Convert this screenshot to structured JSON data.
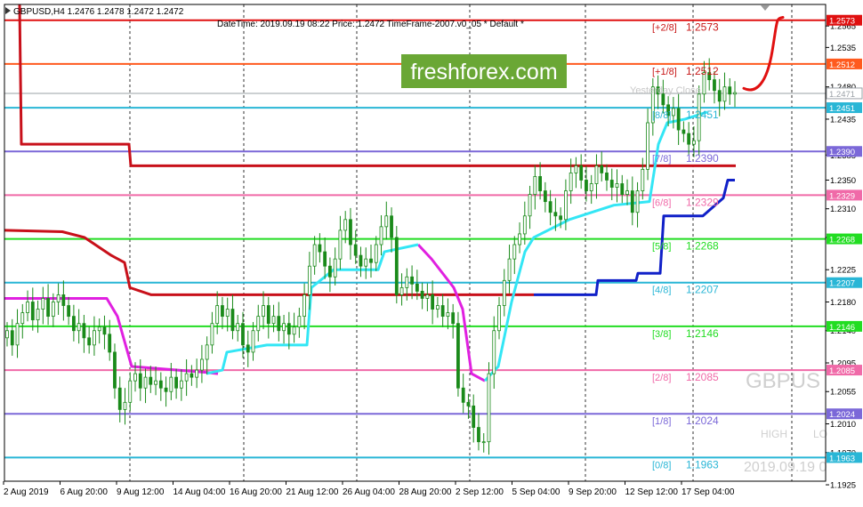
{
  "header": {
    "symbol_line": "GBPUSD,H4  1.2476 1.2478 1.2472 1.2472",
    "info_line": "DateTime: 2019.09.19 08:22    Price: 1.2472    TimeFrame-2007.v0_05    *  Default   *"
  },
  "watermark": {
    "brand": "freshforex.com",
    "symbol": "GBPUS",
    "high_label": "HIGH",
    "low_label": "LO",
    "date": "2019.09.19 0",
    "yesterday_close": "Yesterday Close"
  },
  "colors": {
    "candle": "#1a8a1a",
    "brand_bg": "#6aa735",
    "murrey_red": "#d8141e",
    "cyan_line": "#33e6f5",
    "magenta_line": "#e020e0",
    "blue_line": "#1020c8",
    "dark_red_line": "#c8101a"
  },
  "chart_data": {
    "type": "candlestick",
    "symbol": "GBPUSD",
    "timeframe": "H4",
    "price_axis": {
      "ylim": [
        1.193,
        1.2595
      ],
      "tick_labels": [
        "1.2565",
        "1.2535",
        "1.2480",
        "1.2435",
        "1.2385",
        "1.2350",
        "1.2310",
        "1.2270",
        "1.2225",
        "1.2180",
        "1.2140",
        "1.2095",
        "1.2055",
        "1.2010",
        "1.1970",
        "1.1925"
      ]
    },
    "time_axis": {
      "labels": [
        "2 Aug 2019",
        "6 Aug 20:00",
        "9 Aug 12:00",
        "14 Aug 04:00",
        "16 Aug 20:00",
        "21 Aug 12:00",
        "26 Aug 04:00",
        "28 Aug 20:00",
        "2 Sep 12:00",
        "5 Sep 04:00",
        "9 Sep 20:00",
        "12 Sep 12:00",
        "17 Sep 04:00"
      ]
    },
    "murrey_levels": [
      {
        "label": "[+2/8]",
        "value": "1.2573",
        "price": 1.2573,
        "color": "#e01010"
      },
      {
        "label": "[+1/8]",
        "value": "1.2512",
        "price": 1.2512,
        "color": "#ff5a1e"
      },
      {
        "label": "[8/8]",
        "value": "1.2451",
        "price": 1.2451,
        "color": "#29b6d6"
      },
      {
        "label": "[7/8]",
        "value": "1.2390",
        "price": 1.239,
        "color": "#7b68d8"
      },
      {
        "label": "[6/8]",
        "value": "1.2329",
        "price": 1.2329,
        "color": "#f06aa8"
      },
      {
        "label": "[5/8]",
        "value": "1.2268",
        "price": 1.2268,
        "color": "#22dd22"
      },
      {
        "label": "[4/8]",
        "value": "1.2207",
        "price": 1.2207,
        "color": "#29b6d6"
      },
      {
        "label": "[3/8]",
        "value": "1.2146",
        "price": 1.2146,
        "color": "#22dd22"
      },
      {
        "label": "[2/8]",
        "value": "1.2085",
        "price": 1.2085,
        "color": "#f06aa8"
      },
      {
        "label": "[1/8]",
        "value": "1.2024",
        "price": 1.2024,
        "color": "#7b68d8"
      },
      {
        "label": "[0/8]",
        "value": "1.1963",
        "price": 1.1963,
        "color": "#29b6d6"
      }
    ],
    "current_price": {
      "value": "1.2471",
      "price": 1.2471
    },
    "close_series": [
      1.214,
      1.212,
      1.215,
      1.2165,
      1.218,
      1.2155,
      1.217,
      1.2185,
      1.216,
      1.218,
      1.219,
      1.2175,
      1.216,
      1.214,
      1.215,
      1.213,
      1.212,
      1.214,
      1.2145,
      1.2135,
      1.211,
      1.206,
      1.203,
      1.204,
      1.207,
      1.208,
      1.206,
      1.2075,
      1.2065,
      1.207,
      1.206,
      1.2055,
      1.2075,
      1.206,
      1.207,
      1.208,
      1.2075,
      1.2085,
      1.21,
      1.212,
      1.215,
      1.2175,
      1.216,
      1.217,
      1.214,
      1.215,
      1.212,
      1.211,
      1.214,
      1.216,
      1.2175,
      1.215,
      1.216,
      1.214,
      1.215,
      1.2135,
      1.2145,
      1.216,
      1.219,
      1.223,
      1.226,
      1.225,
      1.223,
      1.2215,
      1.224,
      1.228,
      1.2295,
      1.226,
      1.2245,
      1.223,
      1.224,
      1.2235,
      1.226,
      1.2285,
      1.23,
      1.227,
      1.219,
      1.22,
      1.2215,
      1.2205,
      1.2195,
      1.2185,
      1.219,
      1.217,
      1.2175,
      1.216,
      1.2165,
      1.215,
      1.206,
      1.204,
      1.2035,
      1.2005,
      1.1985,
      1.1985,
      1.208,
      1.214,
      1.2175,
      1.221,
      1.224,
      1.226,
      1.2275,
      1.23,
      1.233,
      1.2355,
      1.2335,
      1.232,
      1.2305,
      1.23,
      1.2295,
      1.2335,
      1.236,
      1.237,
      1.235,
      1.2335,
      1.2345,
      1.237,
      1.236,
      1.235,
      1.234,
      1.2345,
      1.233,
      1.2335,
      1.2305,
      1.2335,
      1.2365,
      1.243,
      1.248,
      1.247,
      1.2455,
      1.244,
      1.245,
      1.242,
      1.2415,
      1.24,
      1.2405,
      1.247,
      1.25,
      1.249,
      1.2475,
      1.246,
      1.248,
      1.247,
      1.2472
    ]
  }
}
